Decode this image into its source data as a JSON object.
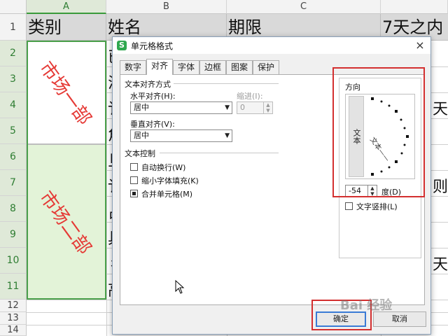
{
  "sheet": {
    "columns": [
      "A",
      "B",
      "C"
    ],
    "rows": [
      "1",
      "2",
      "3",
      "4",
      "5",
      "6",
      "7",
      "8",
      "9",
      "10",
      "11",
      "12",
      "13",
      "14"
    ],
    "headers": [
      "类别",
      "姓名",
      "期限",
      "7天之内"
    ],
    "merged_1": "市场一部",
    "merged_2": "市场二部",
    "col_b_edge": [
      "已",
      "汤",
      "讠",
      "角",
      "旦",
      "讠",
      "占",
      "具",
      "彳",
      "高"
    ],
    "col_d_edge": [
      "天",
      "则",
      "天"
    ]
  },
  "dialog": {
    "title": "单元格格式",
    "app_icon": "S",
    "close": "×",
    "tabs": [
      "数字",
      "对齐",
      "字体",
      "边框",
      "图案",
      "保护"
    ],
    "active_tab": "对齐",
    "text_align_section": "文本对齐方式",
    "horizontal_label": "水平对齐(H):",
    "horizontal_value": "居中",
    "indent_label": "缩进(I):",
    "indent_value": "0",
    "vertical_label": "垂直对齐(V):",
    "vertical_value": "居中",
    "text_control_section": "文本控制",
    "checkboxes": [
      {
        "label": "自动换行(W)",
        "checked": false
      },
      {
        "label": "缩小字体填充(K)",
        "checked": false
      },
      {
        "label": "合并单元格(M)",
        "checked": true
      }
    ],
    "orientation_title": "方向",
    "vertical_text": "文本",
    "rotated_text": "文本——",
    "degree_value": "-54",
    "degree_label": "度(D)",
    "stack_label": "文字竖排(L)",
    "ok": "确定",
    "cancel": "取消"
  },
  "watermark": "Bai 经验",
  "colors": {
    "selection_green": "#4aa04a",
    "merged_text": "#e53935",
    "highlight_red": "#d32f2f"
  }
}
